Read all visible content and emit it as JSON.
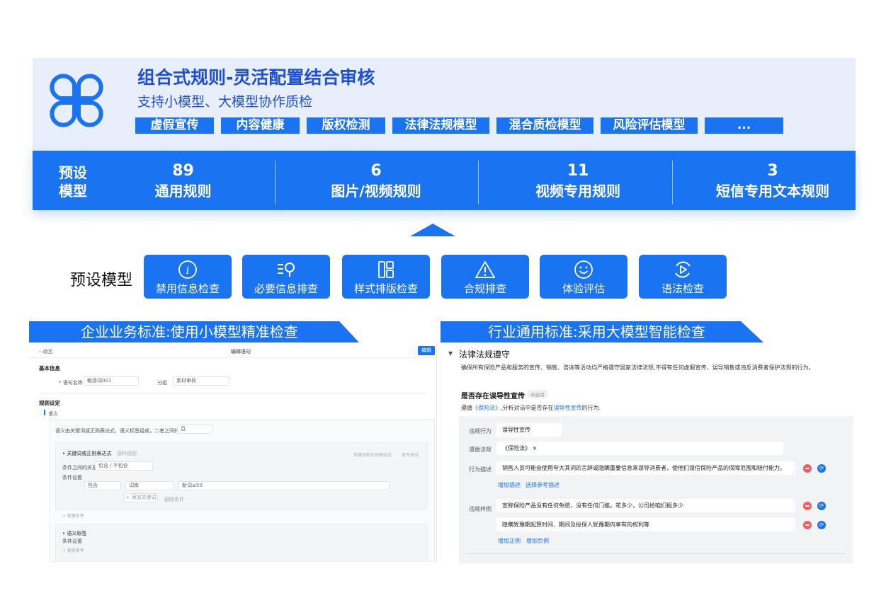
{
  "banner": {
    "title": "组合式规则-灵活配置结合审核",
    "subtitle": "支持小模型、大模型协作质检",
    "tags": [
      "虚假宣传",
      "内容健康",
      "版权检测",
      "法律法规模型",
      "混合质检模型",
      "风险评估模型",
      "..."
    ]
  },
  "stats": {
    "label_line1": "预设",
    "label_line2": "模型",
    "items": [
      {
        "value": "89",
        "label": "通用规则"
      },
      {
        "value": "6",
        "label": "图片/视频规则"
      },
      {
        "value": "11",
        "label": "视频专用规则"
      },
      {
        "value": "3",
        "label": "短信专用文本规则"
      }
    ]
  },
  "preset": {
    "title": "预设模型",
    "buttons": [
      {
        "label": "禁用信息检查",
        "icon": "info-icon"
      },
      {
        "label": "必要信息排查",
        "icon": "search-list-icon"
      },
      {
        "label": "样式排版检查",
        "icon": "layout-icon"
      },
      {
        "label": "合规排查",
        "icon": "warning-icon"
      },
      {
        "label": "体验评估",
        "icon": "smile-icon"
      },
      {
        "label": "语法检查",
        "icon": "play-refresh-icon"
      }
    ]
  },
  "sections": {
    "left": "企业业务标准:使用小模型精准检查",
    "right": "行业通用标准:采用大模型智能检查"
  },
  "left_panel": {
    "back": "‹ 返回",
    "title": "编辑语句",
    "edit_button": "编辑",
    "basic_info": "基本信息",
    "name_label": "* 语句名称",
    "name_value": "敏感词001",
    "group_label": "分组",
    "group_value": "素材审核",
    "rule_settings": "规则设定",
    "semantic": "语义",
    "semantic_desc": "语义由关键词或正则表达式、语义标签组成，二者之间的关系",
    "relation_value": "且",
    "kw_title": "• 关键词或正则表达式",
    "kw_toggle": "语料规则",
    "kw_right1": "关键词和正则表达式",
    "kw_right2": "条件测试",
    "cond_relation_label": "条件之间的关系",
    "cond_relation_value": "包含 / 不包含",
    "cond_settings": "条件设置",
    "cond_row": [
      "包含",
      "词库",
      "新词≤50"
    ],
    "add_kw": "+ 添加关键词",
    "delete": "删除条件",
    "add_cond": "+ 新建条件",
    "semtag_title": "• 语义标签",
    "semtag_cond": "条件设置",
    "semtag_add": "+ 新建条件"
  },
  "right_panel": {
    "title": "法律法规遵守",
    "desc": "确保所有保险产品和服务的宣传、销售、咨询等活动均严格遵守国家法律法规,不得有任何虚假宣传、误导销售或违反消费者保护法规的行为。",
    "question": "是否存在误导性宣传",
    "badge": "未启用",
    "line_pre": "遵循",
    "line_law": "《保险法》",
    "line_mid": ",分析对话中是否存在",
    "line_term": "误导性宣传",
    "line_post": "的行为.",
    "violation_label": "违规行为",
    "violation_value": "误导性宣传",
    "law_label": "遵循法规",
    "law_value": "《保险法》 ×",
    "behavior_label": "行为描述",
    "behavior_value": "销售人员可能会使用夸大其词的言辞或隐瞒重要信息来误导消费者，使他们误信保险产品的保障范围和赔付能力。",
    "behavior_links": [
      "增加描述",
      "选择参考描述"
    ],
    "example_label": "违规样例",
    "example1": "宣称保险产品没有任何免赔，没有任何门槛。花多少，公司给咱们报多少",
    "example2": "隐瞒犹豫期起算时间、期间及投保人犹豫期内享有的权利等",
    "example_links": [
      "增加正例",
      "增加负例"
    ]
  },
  "colors": {
    "accent": "#1a73f0",
    "banner_bg": "#e8eefb",
    "title": "#1d4fd8"
  }
}
